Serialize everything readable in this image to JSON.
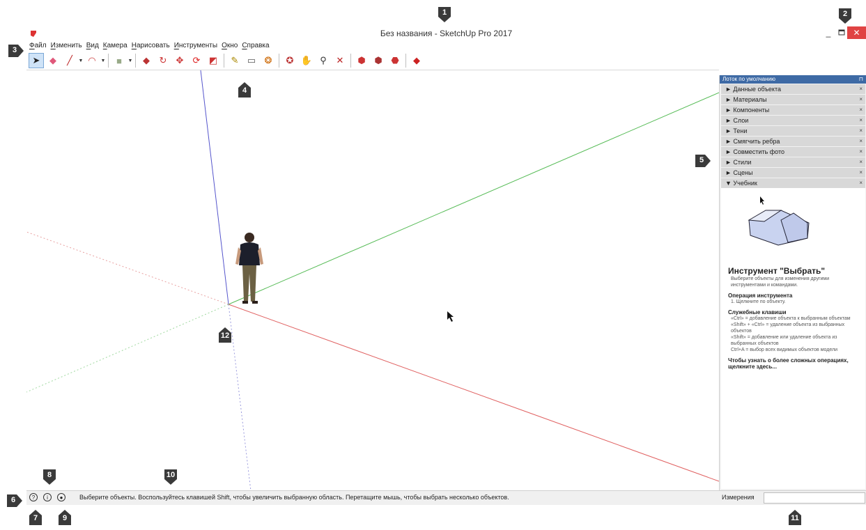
{
  "window": {
    "title": "Без названия - SketchUp Pro 2017",
    "min": "_",
    "close": "✕"
  },
  "menu": [
    "Файл",
    "Изменить",
    "Вид",
    "Камера",
    "Нарисовать",
    "Инструменты",
    "Окно",
    "Справка"
  ],
  "toolbar": {
    "tools": [
      {
        "name": "select-tool-icon",
        "glyph": "➤",
        "color": "#222"
      },
      {
        "name": "eraser-tool-icon",
        "glyph": "◆",
        "color": "#e0587a"
      },
      {
        "name": "line-tool-icon",
        "glyph": "╱",
        "color": "#b22"
      },
      {
        "name": "arc-tool-icon",
        "glyph": "◠",
        "color": "#c44"
      },
      {
        "name": "rectangle-tool-icon",
        "glyph": "■",
        "color": "#9a8"
      },
      {
        "name": "push-pull-tool-icon",
        "glyph": "◆",
        "color": "#b33"
      },
      {
        "name": "follow-me-tool-icon",
        "glyph": "↻",
        "color": "#c33"
      },
      {
        "name": "move-tool-icon",
        "glyph": "✥",
        "color": "#c33"
      },
      {
        "name": "rotate-tool-icon",
        "glyph": "⟳",
        "color": "#d22"
      },
      {
        "name": "scale-tool-icon",
        "glyph": "◩",
        "color": "#c33"
      },
      {
        "name": "tape-measure-tool-icon",
        "glyph": "✎",
        "color": "#a80"
      },
      {
        "name": "text-tool-icon",
        "glyph": "▭",
        "color": "#555"
      },
      {
        "name": "paint-bucket-tool-icon",
        "glyph": "❂",
        "color": "#c60"
      },
      {
        "name": "orbit-tool-icon",
        "glyph": "✪",
        "color": "#b33"
      },
      {
        "name": "pan-tool-icon",
        "glyph": "✋",
        "color": "#c9a"
      },
      {
        "name": "zoom-tool-icon",
        "glyph": "⚲",
        "color": "#333"
      },
      {
        "name": "zoom-extents-tool-icon",
        "glyph": "✕",
        "color": "#b22"
      },
      {
        "name": "warehouse-tool-icon",
        "glyph": "⬢",
        "color": "#c33"
      },
      {
        "name": "share-model-tool-icon",
        "glyph": "⬢",
        "color": "#a33"
      },
      {
        "name": "extension-warehouse-tool-icon",
        "glyph": "⬣",
        "color": "#c33"
      },
      {
        "name": "ruby-tool-icon",
        "glyph": "◆",
        "color": "#c22"
      }
    ]
  },
  "tray": {
    "title": "Лоток по умолчанию",
    "pin": "⊓",
    "panels": [
      "Данные объекта",
      "Материалы",
      "Компоненты",
      "Слои",
      "Тени",
      "Смягчить ребра",
      "Совместить фото",
      "Стили",
      "Сцены"
    ],
    "open_panel": "Учебник",
    "collapsed_marker": "►",
    "open_marker": "▼",
    "close_glyph": "×",
    "tutor": {
      "heading": "Инструмент \"Выбрать\"",
      "intro": "Выберите объекты для изменения другими инструментами и командами.",
      "op_title": "Операция инструмента",
      "op_text": "1. Щелкните по объекту.",
      "keys_title": "Служебные клавиши",
      "keys": [
        "«Ctrl» = добавление объекта к выбранным объектам",
        "«Shift» + «Ctrl» = удаление объекта из выбранных объектов",
        "«Shift» = добавление или удаление объекта из выбранных объектов",
        "Ctrl+A = выбор всех видимых объектов модели"
      ],
      "more": "Чтобы узнать о более сложных операциях, щелкните здесь..."
    }
  },
  "status": {
    "text": "Выберите объекты. Воспользуйтесь клавишей Shift, чтобы увеличить выбранную область. Перетащите мышь, чтобы выбрать несколько объектов.",
    "measure_label": "Измерения",
    "icons": [
      {
        "name": "geo-location-icon",
        "glyph": "?"
      },
      {
        "name": "credits-icon",
        "glyph": "i"
      },
      {
        "name": "user-account-icon",
        "glyph": "●"
      }
    ]
  },
  "callouts": [
    "1",
    "2",
    "3",
    "4",
    "5",
    "6",
    "7",
    "8",
    "9",
    "10",
    "11",
    "12"
  ],
  "colors": {
    "callout": "#3a3a3a",
    "axis_red": "#e06060",
    "axis_green": "#55bb55",
    "axis_blue": "#5555cc"
  }
}
